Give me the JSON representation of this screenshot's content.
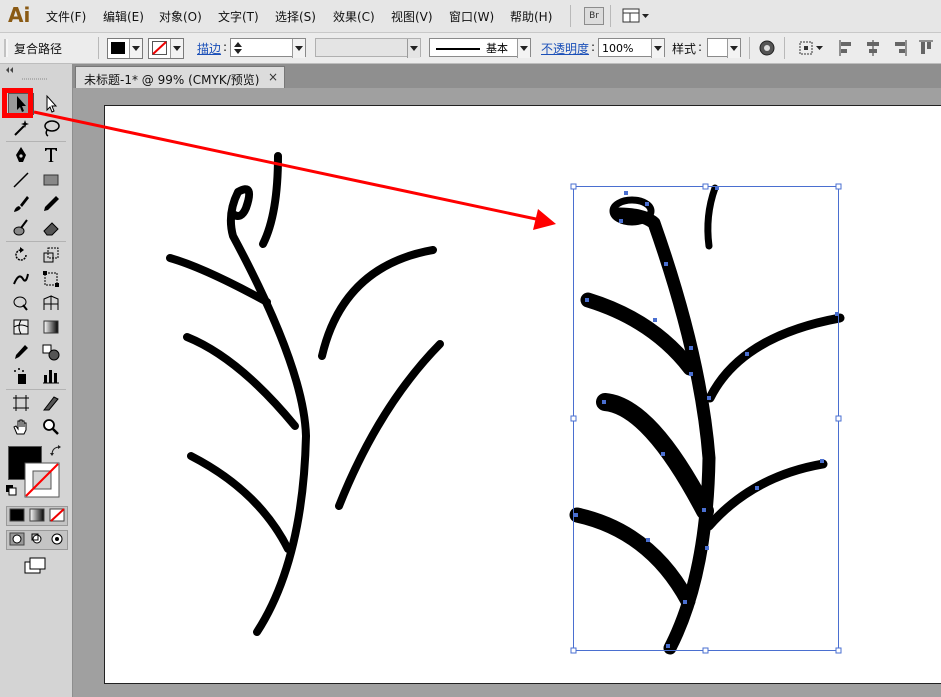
{
  "app": {
    "logo": "Ai"
  },
  "menu": {
    "items": [
      "文件(F)",
      "编辑(E)",
      "对象(O)",
      "文字(T)",
      "选择(S)",
      "效果(C)",
      "视图(V)",
      "窗口(W)",
      "帮助(H)"
    ],
    "bridge_label": "Br"
  },
  "control_bar": {
    "object_type": "复合路径",
    "stroke_label": "描边",
    "stroke_weight": "",
    "stroke_profile": "基本",
    "opacity_label": "不透明度",
    "opacity_value": "100%",
    "style_label": "样式"
  },
  "document": {
    "tab_title": "未标题-1* @ 99% (CMYK/预览)",
    "close_glyph": "×"
  },
  "colors": {
    "accent_red": "#ff0000",
    "selection_blue": "#4a6fd0",
    "fill": "#000000"
  },
  "tools": [
    "selection-tool",
    "direct-selection-tool",
    "magic-wand-tool",
    "lasso-tool",
    "pen-tool",
    "type-tool",
    "line-tool",
    "rectangle-tool",
    "paintbrush-tool",
    "pencil-tool",
    "blob-brush-tool",
    "eraser-tool",
    "rotate-tool",
    "scale-tool",
    "warp-tool",
    "free-transform-tool",
    "shape-builder-tool",
    "perspective-grid-tool",
    "mesh-tool",
    "gradient-tool",
    "eyedropper-tool",
    "blend-tool",
    "symbol-sprayer-tool",
    "column-graph-tool",
    "artboard-tool",
    "slice-tool",
    "hand-tool",
    "zoom-tool"
  ]
}
